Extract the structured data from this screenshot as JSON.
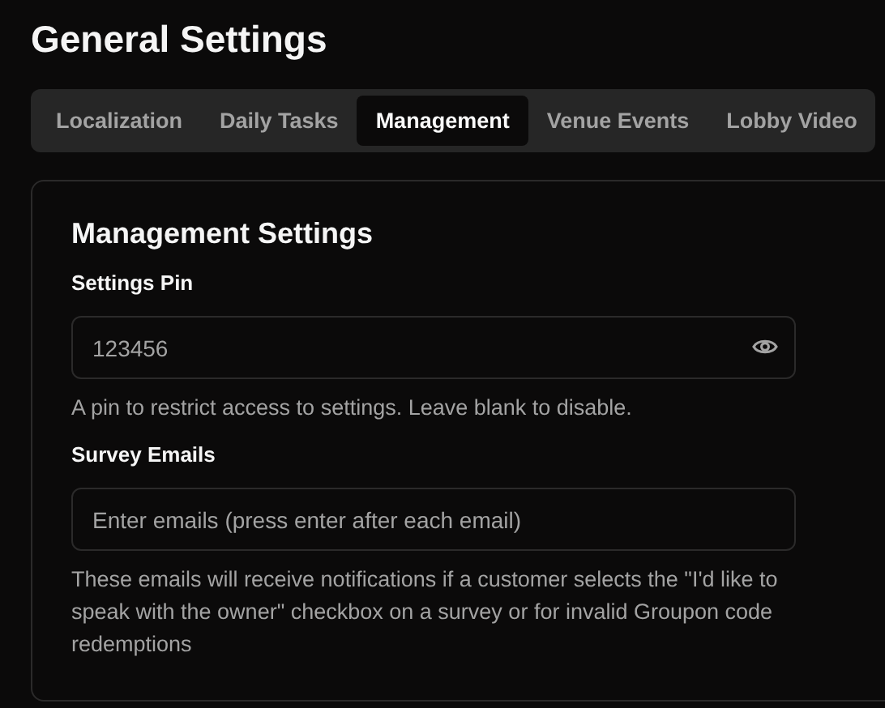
{
  "page": {
    "title": "General Settings"
  },
  "tabs": [
    {
      "label": "Localization",
      "selected": false
    },
    {
      "label": "Daily Tasks",
      "selected": false
    },
    {
      "label": "Management",
      "selected": true
    },
    {
      "label": "Venue Events",
      "selected": false
    },
    {
      "label": "Lobby Video",
      "selected": false
    }
  ],
  "card": {
    "title": "Management Settings",
    "fields": [
      {
        "label": "Settings Pin",
        "value": "123456",
        "kind": "password",
        "help": "A pin to restrict access to settings. Leave blank to disable."
      },
      {
        "label": "Survey Emails",
        "placeholder": "Enter emails (press enter after each email)",
        "kind": "text",
        "help": "These emails will receive notifications if a customer selects the \"I'd like to speak with the owner\" checkbox on a survey or for invalid Groupon code redemptions"
      }
    ]
  }
}
